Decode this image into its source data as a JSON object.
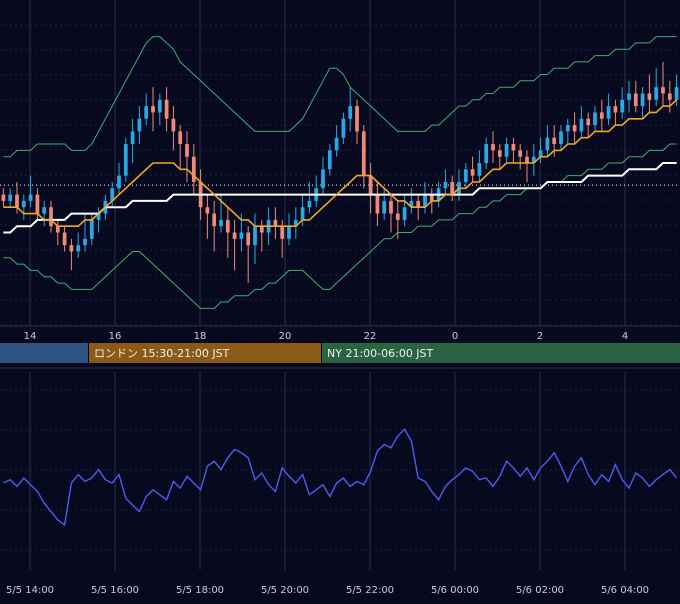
{
  "chart_data": [
    {
      "type": "candlestick",
      "x_ticks": [
        "14",
        "16",
        "18",
        "20",
        "22",
        "0",
        "2",
        "4"
      ],
      "grid": true,
      "colors": {
        "bull": "#2aa8e6",
        "bear": "#f08a78",
        "ma_fast": "#f5a623",
        "ma_slow": "#ffffff",
        "bollinger": "#3fae6a",
        "reference_line": "#ffffff"
      },
      "candles": [
        [
          50,
          49,
          51,
          48
        ],
        [
          49,
          50,
          51,
          48
        ],
        [
          50,
          48,
          52,
          47
        ],
        [
          48,
          49,
          50,
          46
        ],
        [
          49,
          50,
          53,
          48
        ],
        [
          50,
          47,
          51,
          46
        ],
        [
          47,
          48,
          49,
          45
        ],
        [
          48,
          45,
          49,
          44
        ],
        [
          45,
          44,
          46,
          42
        ],
        [
          44,
          42,
          45,
          41
        ],
        [
          42,
          41,
          43,
          38
        ],
        [
          41,
          42,
          44,
          40
        ],
        [
          42,
          43,
          47,
          41
        ],
        [
          43,
          46,
          47,
          42
        ],
        [
          46,
          47,
          48,
          44
        ],
        [
          47,
          49,
          50,
          46
        ],
        [
          49,
          51,
          52,
          48
        ],
        [
          51,
          53,
          55,
          50
        ],
        [
          53,
          58,
          59,
          52
        ],
        [
          58,
          60,
          62,
          55
        ],
        [
          60,
          62,
          64,
          58
        ],
        [
          62,
          64,
          66,
          61
        ],
        [
          64,
          63,
          67,
          60
        ],
        [
          63,
          65,
          66,
          61
        ],
        [
          65,
          62,
          67,
          60
        ],
        [
          62,
          60,
          64,
          57
        ],
        [
          60,
          58,
          61,
          54
        ],
        [
          58,
          56,
          60,
          52
        ],
        [
          56,
          52,
          58,
          50
        ],
        [
          52,
          48,
          54,
          46
        ],
        [
          48,
          47,
          50,
          43
        ],
        [
          47,
          45,
          49,
          41
        ],
        [
          45,
          46,
          50,
          44
        ],
        [
          46,
          44,
          48,
          40
        ],
        [
          44,
          43,
          46,
          38
        ],
        [
          43,
          44,
          47,
          41
        ],
        [
          44,
          42,
          45,
          36
        ],
        [
          42,
          45,
          47,
          39
        ],
        [
          45,
          44,
          46,
          41
        ],
        [
          44,
          46,
          48,
          42
        ],
        [
          46,
          45,
          48,
          43
        ],
        [
          45,
          43,
          46,
          40
        ],
        [
          43,
          45,
          47,
          42
        ],
        [
          45,
          46,
          48,
          43
        ],
        [
          46,
          48,
          50,
          45
        ],
        [
          48,
          49,
          52,
          47
        ],
        [
          49,
          51,
          53,
          48
        ],
        [
          51,
          54,
          56,
          50
        ],
        [
          54,
          57,
          58,
          53
        ],
        [
          57,
          59,
          61,
          56
        ],
        [
          59,
          62,
          63,
          58
        ],
        [
          62,
          64,
          67,
          60
        ],
        [
          64,
          60,
          65,
          58
        ],
        [
          60,
          53,
          61,
          51
        ],
        [
          53,
          50,
          55,
          47
        ],
        [
          50,
          47,
          52,
          45
        ],
        [
          47,
          49,
          51,
          46
        ],
        [
          49,
          47,
          50,
          44
        ],
        [
          47,
          46,
          49,
          43
        ],
        [
          46,
          48,
          50,
          45
        ],
        [
          48,
          49,
          51,
          47
        ],
        [
          49,
          48,
          50,
          46
        ],
        [
          48,
          50,
          52,
          47
        ],
        [
          50,
          49,
          51,
          47
        ],
        [
          49,
          51,
          52,
          48
        ],
        [
          51,
          52,
          54,
          50
        ],
        [
          52,
          50,
          53,
          49
        ],
        [
          50,
          52,
          54,
          49
        ],
        [
          52,
          54,
          55,
          51
        ],
        [
          54,
          53,
          56,
          52
        ],
        [
          53,
          55,
          57,
          52
        ],
        [
          55,
          58,
          59,
          54
        ],
        [
          58,
          57,
          60,
          55
        ],
        [
          57,
          56,
          58,
          54
        ],
        [
          56,
          58,
          59,
          55
        ],
        [
          58,
          57,
          59,
          55
        ],
        [
          57,
          56,
          58,
          54
        ],
        [
          56,
          55,
          57,
          52
        ],
        [
          55,
          56,
          58,
          53
        ],
        [
          56,
          57,
          59,
          55
        ],
        [
          57,
          59,
          61,
          56
        ],
        [
          59,
          58,
          61,
          56
        ],
        [
          58,
          60,
          61,
          57
        ],
        [
          60,
          61,
          62,
          58
        ],
        [
          61,
          60,
          63,
          58
        ],
        [
          60,
          62,
          64,
          59
        ],
        [
          62,
          61,
          63,
          59
        ],
        [
          61,
          63,
          64,
          60
        ],
        [
          63,
          62,
          65,
          60
        ],
        [
          62,
          64,
          66,
          61
        ],
        [
          64,
          63,
          65,
          61
        ],
        [
          63,
          65,
          67,
          62
        ],
        [
          65,
          66,
          68,
          63
        ],
        [
          66,
          64,
          68,
          63
        ],
        [
          64,
          66,
          67,
          62
        ],
        [
          66,
          65,
          69,
          63
        ],
        [
          65,
          67,
          70,
          64
        ],
        [
          67,
          66,
          71,
          64
        ],
        [
          66,
          65,
          68,
          63
        ],
        [
          65,
          67,
          69,
          64
        ]
      ],
      "ma_fast": [
        48,
        48,
        48,
        47,
        47,
        47,
        46,
        46,
        45,
        45,
        45,
        45,
        46,
        46,
        47,
        48,
        49,
        50,
        51,
        52,
        53,
        54,
        55,
        55,
        55,
        55,
        54,
        54,
        53,
        52,
        51,
        50,
        49,
        48,
        47,
        46,
        46,
        45,
        45,
        45,
        45,
        45,
        45,
        45,
        46,
        46,
        47,
        48,
        49,
        50,
        51,
        52,
        53,
        53,
        53,
        52,
        51,
        50,
        49,
        49,
        48,
        48,
        48,
        49,
        49,
        50,
        50,
        51,
        51,
        52,
        52,
        53,
        54,
        54,
        55,
        55,
        55,
        55,
        55,
        56,
        56,
        57,
        57,
        58,
        58,
        59,
        59,
        60,
        60,
        60,
        61,
        61,
        62,
        62,
        62,
        63,
        63,
        64,
        64,
        65
      ],
      "ma_slow": [
        44,
        44,
        45,
        45,
        45,
        46,
        46,
        46,
        46,
        46,
        47,
        47,
        47,
        47,
        47,
        48,
        48,
        48,
        48,
        49,
        49,
        49,
        49,
        49,
        49,
        50,
        50,
        50,
        50,
        50,
        50,
        50,
        50,
        50,
        50,
        50,
        50,
        50,
        50,
        50,
        50,
        50,
        50,
        50,
        50,
        50,
        50,
        50,
        50,
        50,
        50,
        50,
        50,
        50,
        50,
        50,
        50,
        50,
        50,
        50,
        50,
        50,
        50,
        50,
        50,
        50,
        50,
        50,
        50,
        50,
        51,
        51,
        51,
        51,
        51,
        51,
        51,
        51,
        51,
        51,
        52,
        52,
        52,
        52,
        52,
        52,
        53,
        53,
        53,
        53,
        53,
        53,
        54,
        54,
        54,
        54,
        54,
        55,
        55,
        55
      ],
      "bb_upper": [
        56,
        56,
        57,
        57,
        57,
        58,
        58,
        58,
        58,
        58,
        57,
        57,
        57,
        58,
        60,
        62,
        64,
        66,
        68,
        70,
        72,
        74,
        75,
        75,
        74,
        73,
        71,
        70,
        69,
        68,
        67,
        66,
        65,
        64,
        63,
        62,
        61,
        60,
        60,
        60,
        60,
        60,
        60,
        61,
        62,
        64,
        66,
        68,
        70,
        70,
        69,
        67,
        66,
        65,
        64,
        63,
        62,
        61,
        60,
        60,
        60,
        60,
        60,
        61,
        61,
        62,
        63,
        64,
        64,
        65,
        65,
        66,
        66,
        67,
        67,
        67,
        68,
        68,
        68,
        69,
        69,
        70,
        70,
        70,
        71,
        71,
        71,
        72,
        72,
        72,
        73,
        73,
        73,
        74,
        74,
        74,
        75,
        75,
        75,
        75
      ],
      "bb_lower": [
        40,
        40,
        39,
        39,
        38,
        38,
        37,
        37,
        36,
        36,
        35,
        35,
        35,
        35,
        36,
        37,
        38,
        39,
        40,
        41,
        41,
        40,
        39,
        38,
        37,
        36,
        35,
        34,
        33,
        32,
        32,
        32,
        33,
        33,
        34,
        34,
        34,
        35,
        35,
        36,
        36,
        37,
        38,
        38,
        38,
        37,
        36,
        35,
        35,
        36,
        37,
        38,
        39,
        40,
        41,
        42,
        43,
        43,
        44,
        44,
        44,
        45,
        45,
        45,
        46,
        46,
        46,
        47,
        47,
        47,
        48,
        48,
        49,
        49,
        50,
        50,
        50,
        51,
        51,
        51,
        52,
        52,
        52,
        53,
        53,
        53,
        54,
        54,
        54,
        55,
        55,
        55,
        56,
        56,
        56,
        57,
        57,
        57,
        58,
        58
      ],
      "reference_level": 51.5,
      "ylim": [
        30,
        80
      ]
    },
    {
      "type": "line",
      "x_ticks": [
        "5/5 14:00",
        "5/5 16:00",
        "5/5 18:00",
        "5/5 20:00",
        "5/5 22:00",
        "5/6 00:00",
        "5/6 02:00",
        "5/6 04:00"
      ],
      "grid": true,
      "colors": {
        "line": "#4b5cf0"
      },
      "ylim": [
        0,
        100
      ],
      "values": [
        47,
        49,
        45,
        50,
        46,
        42,
        35,
        30,
        25,
        22,
        47,
        52,
        48,
        50,
        55,
        49,
        47,
        52,
        38,
        34,
        30,
        39,
        43,
        40,
        37,
        48,
        44,
        51,
        47,
        43,
        57,
        60,
        55,
        62,
        67,
        65,
        62,
        49,
        53,
        46,
        42,
        56,
        51,
        47,
        52,
        40,
        43,
        46,
        39,
        47,
        50,
        45,
        48,
        46,
        54,
        66,
        70,
        68,
        75,
        79,
        72,
        50,
        48,
        42,
        37,
        45,
        49,
        52,
        56,
        54,
        49,
        50,
        45,
        51,
        60,
        56,
        51,
        56,
        49,
        56,
        60,
        65,
        57,
        48,
        57,
        62,
        52,
        46,
        52,
        48,
        58,
        49,
        44,
        53,
        50,
        45,
        49,
        52,
        55,
        50
      ]
    }
  ],
  "sessions": [
    {
      "label": "",
      "color": "#2d5384"
    },
    {
      "label": "ロンドン 15:30-21:00 JST",
      "color": "#8a5a16"
    },
    {
      "label": "NY 21:00-06:00 JST",
      "color": "#296342"
    }
  ]
}
